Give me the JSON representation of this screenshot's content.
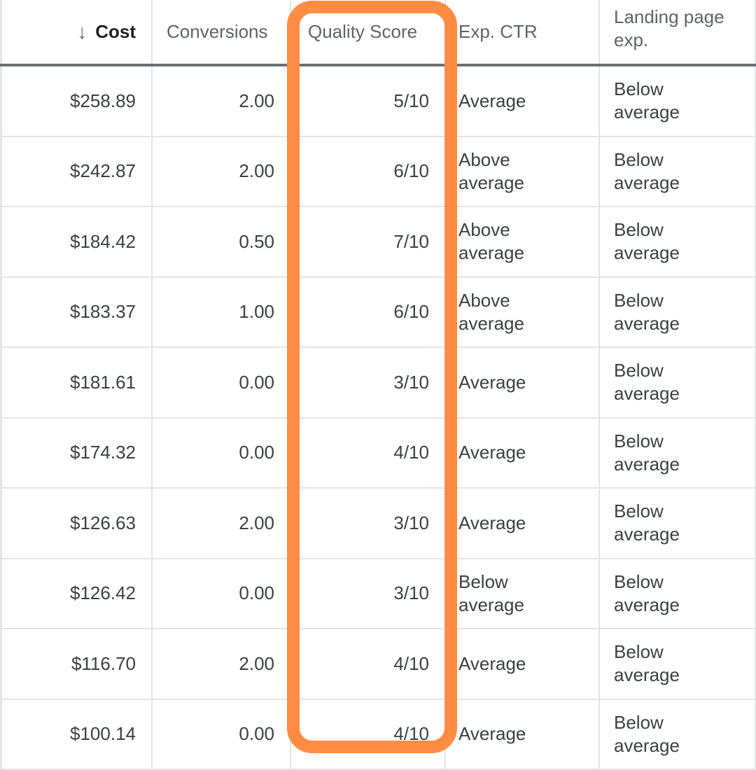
{
  "highlight_color": "#ff8c42",
  "columns": {
    "cost": "Cost",
    "conversions": "Conversions",
    "quality_score": "Quality Score",
    "exp_ctr": "Exp. CTR",
    "landing_page_line1": "Landing page",
    "landing_page_line2": "exp."
  },
  "sort": {
    "column": "Cost",
    "direction": "descending",
    "icon": "arrow-down-icon",
    "glyph": "↓"
  },
  "rows": [
    {
      "cost": "$258.89",
      "conversions": "2.00",
      "quality_score": "5/10",
      "exp_ctr_1": "Average",
      "exp_ctr_2": "",
      "landing_1": "Below",
      "landing_2": "average"
    },
    {
      "cost": "$242.87",
      "conversions": "2.00",
      "quality_score": "6/10",
      "exp_ctr_1": "Above",
      "exp_ctr_2": "average",
      "landing_1": "Below",
      "landing_2": "average"
    },
    {
      "cost": "$184.42",
      "conversions": "0.50",
      "quality_score": "7/10",
      "exp_ctr_1": "Above",
      "exp_ctr_2": "average",
      "landing_1": "Below",
      "landing_2": "average"
    },
    {
      "cost": "$183.37",
      "conversions": "1.00",
      "quality_score": "6/10",
      "exp_ctr_1": "Above",
      "exp_ctr_2": "average",
      "landing_1": "Below",
      "landing_2": "average"
    },
    {
      "cost": "$181.61",
      "conversions": "0.00",
      "quality_score": "3/10",
      "exp_ctr_1": "Average",
      "exp_ctr_2": "",
      "landing_1": "Below",
      "landing_2": "average"
    },
    {
      "cost": "$174.32",
      "conversions": "0.00",
      "quality_score": "4/10",
      "exp_ctr_1": "Average",
      "exp_ctr_2": "",
      "landing_1": "Below",
      "landing_2": "average"
    },
    {
      "cost": "$126.63",
      "conversions": "2.00",
      "quality_score": "3/10",
      "exp_ctr_1": "Average",
      "exp_ctr_2": "",
      "landing_1": "Below",
      "landing_2": "average"
    },
    {
      "cost": "$126.42",
      "conversions": "0.00",
      "quality_score": "3/10",
      "exp_ctr_1": "Below",
      "exp_ctr_2": "average",
      "landing_1": "Below",
      "landing_2": "average"
    },
    {
      "cost": "$116.70",
      "conversions": "2.00",
      "quality_score": "4/10",
      "exp_ctr_1": "Average",
      "exp_ctr_2": "",
      "landing_1": "Below",
      "landing_2": "average"
    },
    {
      "cost": "$100.14",
      "conversions": "0.00",
      "quality_score": "4/10",
      "exp_ctr_1": "Average",
      "exp_ctr_2": "",
      "landing_1": "Below",
      "landing_2": "average"
    }
  ]
}
